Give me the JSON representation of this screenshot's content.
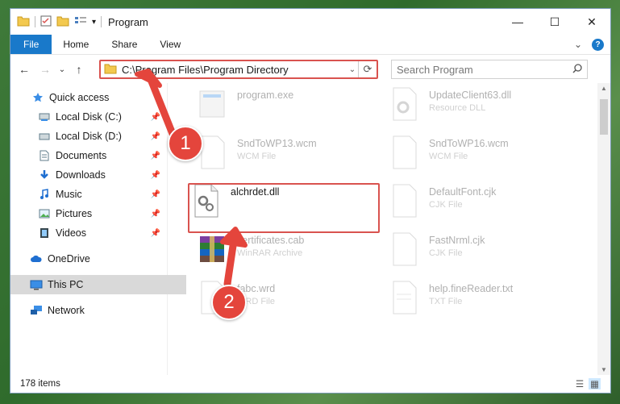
{
  "window": {
    "title": "Program",
    "minimize": "—",
    "maximize": "☐",
    "close": "✕"
  },
  "ribbon": {
    "tabs": [
      "File",
      "Home",
      "Share",
      "View"
    ],
    "expand": "⌄",
    "help": "?"
  },
  "nav": {
    "back": "←",
    "forward": "→",
    "recent": "⌄",
    "up": "↑"
  },
  "address": {
    "path": "C:\\Program Files\\Program Directory",
    "dropdown": "⌄",
    "refresh": "⟳"
  },
  "search": {
    "placeholder": "Search Program",
    "icon": "search-icon"
  },
  "sidebar": {
    "items": [
      {
        "label": "Quick access",
        "icon": "star-icon",
        "pinned": false
      },
      {
        "label": "Local Disk (C:)",
        "icon": "drive-icon",
        "pinned": true
      },
      {
        "label": "Local Disk (D:)",
        "icon": "drive-icon",
        "pinned": true
      },
      {
        "label": "Documents",
        "icon": "documents-icon",
        "pinned": true
      },
      {
        "label": "Downloads",
        "icon": "download-icon",
        "pinned": true
      },
      {
        "label": "Music",
        "icon": "music-icon",
        "pinned": true
      },
      {
        "label": "Pictures",
        "icon": "pictures-icon",
        "pinned": true
      },
      {
        "label": "Videos",
        "icon": "videos-icon",
        "pinned": true
      },
      {
        "label": "OneDrive",
        "icon": "cloud-icon",
        "pinned": false
      },
      {
        "label": "This PC",
        "icon": "computer-icon",
        "pinned": false,
        "selected": true
      },
      {
        "label": "Network",
        "icon": "network-icon",
        "pinned": false
      }
    ]
  },
  "files": [
    {
      "name": "program.exe",
      "type": "",
      "faded": true
    },
    {
      "name": "UpdateClient63.dll",
      "type": "Resource DLL",
      "faded": true
    },
    {
      "name": "SndToWP13.wcm",
      "type": "WCM File",
      "faded": true
    },
    {
      "name": "SndToWP16.wcm",
      "type": "WCM File",
      "faded": true
    },
    {
      "name": "alchrdet.dll",
      "type": "",
      "faded": false
    },
    {
      "name": "DefaultFont.cjk",
      "type": "CJK File",
      "faded": true
    },
    {
      "name": "certificates.cab",
      "type": "WinRAR Archive",
      "faded": true
    },
    {
      "name": "FastNrml.cjk",
      "type": "CJK File",
      "faded": true
    },
    {
      "name": "fabc.wrd",
      "type": "WRD File",
      "faded": true
    },
    {
      "name": "help.fineReader.txt",
      "type": "TXT File",
      "faded": true
    }
  ],
  "status": {
    "count": "178 items"
  },
  "annotations": {
    "step1": "1",
    "step2": "2",
    "color": "#e4453c"
  }
}
